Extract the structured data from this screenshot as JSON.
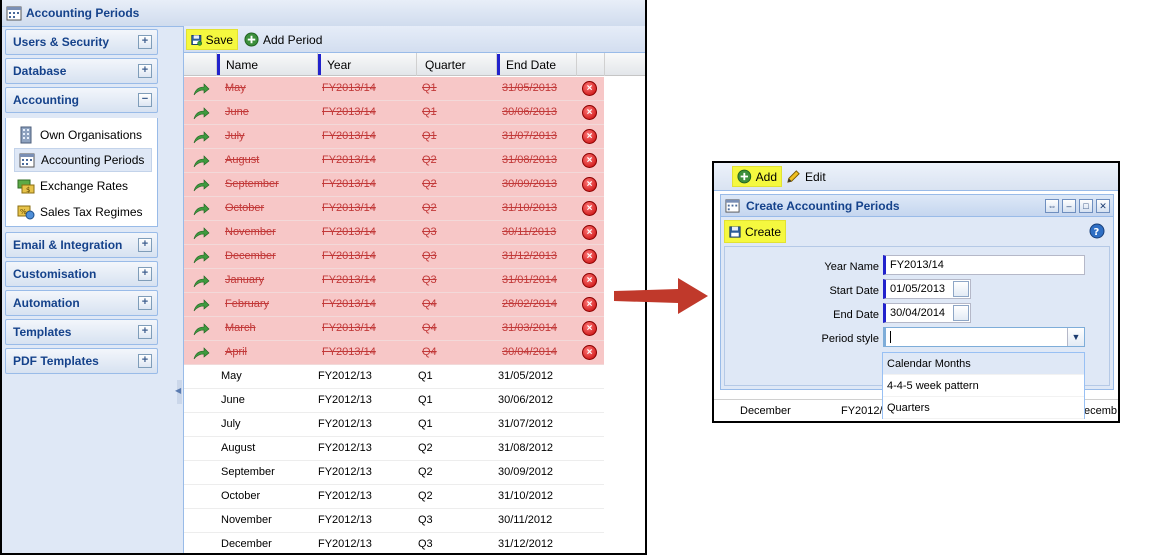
{
  "main": {
    "title": "Accounting Periods",
    "sidebar": {
      "sections": [
        {
          "label": "Users & Security",
          "toggle": "+"
        },
        {
          "label": "Database",
          "toggle": "+"
        },
        {
          "label": "Accounting",
          "toggle": "−"
        },
        {
          "label": "Email & Integration",
          "toggle": "+"
        },
        {
          "label": "Customisation",
          "toggle": "+"
        },
        {
          "label": "Automation",
          "toggle": "+"
        },
        {
          "label": "Templates",
          "toggle": "+"
        },
        {
          "label": "PDF Templates",
          "toggle": "+"
        }
      ],
      "accounting_items": [
        {
          "label": "Own Organisations",
          "icon": "building-icon"
        },
        {
          "label": "Accounting Periods",
          "icon": "calendar-grid-icon"
        },
        {
          "label": "Exchange Rates",
          "icon": "exchange-icon"
        },
        {
          "label": "Sales Tax Regimes",
          "icon": "tax-icon"
        }
      ]
    },
    "toolbar": {
      "save_label": "Save",
      "add_period_label": "Add Period"
    },
    "grid": {
      "columns": [
        "Name",
        "Year",
        "Quarter",
        "End Date"
      ],
      "deleted_rows": [
        [
          "May",
          "FY2013/14",
          "Q1",
          "31/05/2013"
        ],
        [
          "June",
          "FY2013/14",
          "Q1",
          "30/06/2013"
        ],
        [
          "July",
          "FY2013/14",
          "Q1",
          "31/07/2013"
        ],
        [
          "August",
          "FY2013/14",
          "Q2",
          "31/08/2013"
        ],
        [
          "September",
          "FY2013/14",
          "Q2",
          "30/09/2013"
        ],
        [
          "October",
          "FY2013/14",
          "Q2",
          "31/10/2013"
        ],
        [
          "November",
          "FY2013/14",
          "Q3",
          "30/11/2013"
        ],
        [
          "December",
          "FY2013/14",
          "Q3",
          "31/12/2013"
        ],
        [
          "January",
          "FY2013/14",
          "Q3",
          "31/01/2014"
        ],
        [
          "February",
          "FY2013/14",
          "Q4",
          "28/02/2014"
        ],
        [
          "March",
          "FY2013/14",
          "Q4",
          "31/03/2014"
        ],
        [
          "April",
          "FY2013/14",
          "Q4",
          "30/04/2014"
        ]
      ],
      "rows": [
        [
          "May",
          "FY2012/13",
          "Q1",
          "31/05/2012"
        ],
        [
          "June",
          "FY2012/13",
          "Q1",
          "30/06/2012"
        ],
        [
          "July",
          "FY2012/13",
          "Q1",
          "31/07/2012"
        ],
        [
          "August",
          "FY2012/13",
          "Q2",
          "31/08/2012"
        ],
        [
          "September",
          "FY2012/13",
          "Q2",
          "30/09/2012"
        ],
        [
          "October",
          "FY2012/13",
          "Q2",
          "31/10/2012"
        ],
        [
          "November",
          "FY2012/13",
          "Q3",
          "30/11/2012"
        ],
        [
          "December",
          "FY2012/13",
          "Q3",
          "31/12/2012"
        ]
      ]
    }
  },
  "dialog": {
    "toolbar": {
      "add_label": "Add",
      "edit_label": "Edit"
    },
    "title": "Create Accounting Periods",
    "create_label": "Create",
    "help_icon": "?",
    "labels": {
      "year_name": "Year Name",
      "start_date": "Start Date",
      "end_date": "End Date",
      "period_style": "Period style"
    },
    "values": {
      "year_name": "FY2013/14",
      "start_date": "01/05/2013",
      "end_date": "30/04/2014",
      "period_style": ""
    },
    "period_style_options": [
      "Calendar Months",
      "4-4-5 week pattern",
      "Quarters"
    ],
    "behind_row": [
      "December",
      "FY2012/",
      "ecemb"
    ]
  },
  "colors": {
    "deleted_row": "#f7c7c7",
    "highlight": "#f5f83f",
    "arrow": "#c0392b",
    "header_text": "#15428b"
  }
}
